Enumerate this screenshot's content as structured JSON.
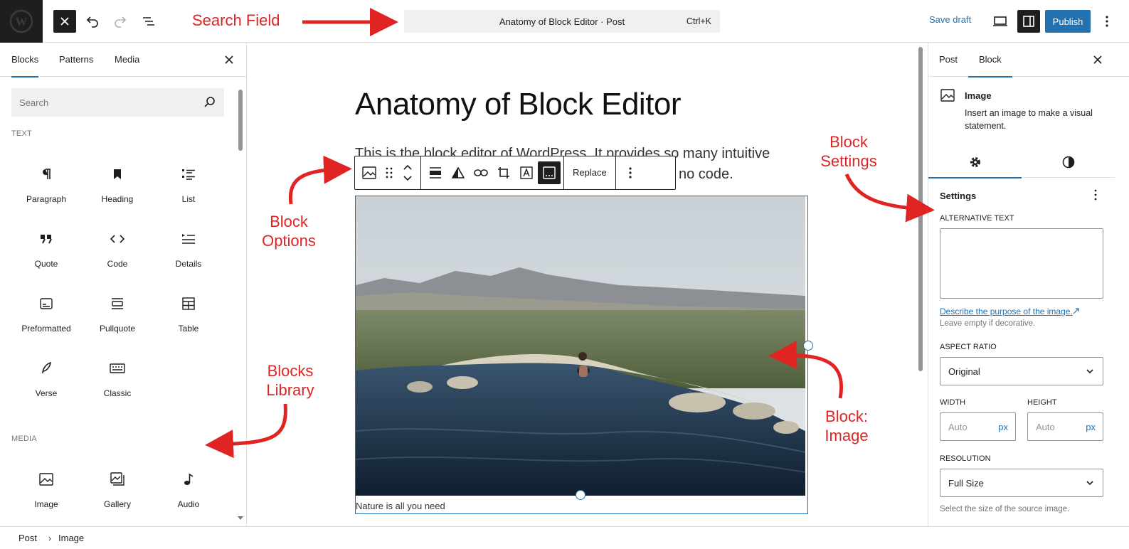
{
  "topbar": {
    "search_text": "Anatomy of Block Editor · Post",
    "search_shortcut": "Ctrl+K",
    "save_draft_label": "Save draft",
    "publish_label": "Publish"
  },
  "left_sidebar": {
    "tabs": [
      {
        "label": "Blocks",
        "active": true
      },
      {
        "label": "Patterns",
        "active": false
      },
      {
        "label": "Media",
        "active": false
      }
    ],
    "search_placeholder": "Search",
    "categories": {
      "text": {
        "label": "TEXT",
        "blocks": [
          {
            "label": "Paragraph",
            "icon": "paragraph-icon"
          },
          {
            "label": "Heading",
            "icon": "heading-icon"
          },
          {
            "label": "List",
            "icon": "list-icon"
          },
          {
            "label": "Quote",
            "icon": "quote-icon"
          },
          {
            "label": "Code",
            "icon": "code-icon"
          },
          {
            "label": "Details",
            "icon": "details-icon"
          },
          {
            "label": "Preformatted",
            "icon": "preformatted-icon"
          },
          {
            "label": "Pullquote",
            "icon": "pullquote-icon"
          },
          {
            "label": "Table",
            "icon": "table-icon"
          },
          {
            "label": "Verse",
            "icon": "verse-icon"
          },
          {
            "label": "Classic",
            "icon": "keyboard-icon"
          }
        ]
      },
      "media": {
        "label": "MEDIA",
        "blocks": [
          {
            "label": "Image",
            "icon": "image-icon"
          },
          {
            "label": "Gallery",
            "icon": "gallery-icon"
          },
          {
            "label": "Audio",
            "icon": "audio-icon"
          }
        ]
      }
    }
  },
  "canvas": {
    "title": "Anatomy of Block Editor",
    "paragraph_line1": "This is the block editor of WordPress. It provides so many intuitive",
    "paragraph_line2": "no code.",
    "toolbar_replace_label": "Replace",
    "caption": "Nature is all you need"
  },
  "right_sidebar": {
    "tabs": [
      {
        "label": "Post",
        "active": false
      },
      {
        "label": "Block",
        "active": true
      }
    ],
    "block_title": "Image",
    "block_description": "Insert an image to make a visual statement.",
    "panel_title": "Settings",
    "alt_text_label": "ALTERNATIVE TEXT",
    "alt_text_value": "",
    "alt_help_link": "Describe the purpose of the image.",
    "alt_help_text": "Leave empty if decorative.",
    "aspect_ratio_label": "ASPECT RATIO",
    "aspect_ratio_value": "Original",
    "width_label": "WIDTH",
    "height_label": "HEIGHT",
    "width_placeholder": "Auto",
    "height_placeholder": "Auto",
    "unit": "px",
    "resolution_label": "RESOLUTION",
    "resolution_value": "Full Size",
    "resolution_help": "Select the size of the source image."
  },
  "breadcrumb": {
    "items": [
      "Post",
      "Image"
    ]
  },
  "annotations": {
    "search_field": "Search Field",
    "block_options": [
      "Block",
      "Options"
    ],
    "block_settings": [
      "Block",
      "Settings"
    ],
    "blocks_library": [
      "Blocks",
      "Library"
    ],
    "block_image": [
      "Block:",
      "Image"
    ]
  },
  "colors": {
    "accent": "#2271b1",
    "dark": "#1e1e1e",
    "annotation": "#e02424"
  }
}
